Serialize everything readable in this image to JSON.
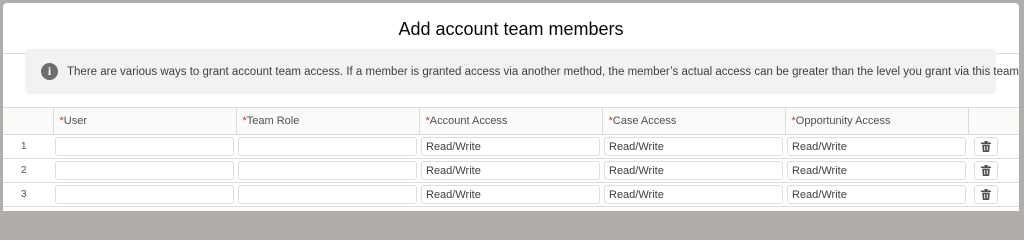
{
  "modal": {
    "title": "Add account team members"
  },
  "notice": {
    "icon": "info-icon",
    "text": "There are various ways to grant account team access. If a member is granted access via another method, the member’s actual access can be greater than the level you grant via this team."
  },
  "table": {
    "required_marker": "*",
    "headers": [
      "User",
      "Team Role",
      "Account Access",
      "Case Access",
      "Opportunity Access"
    ],
    "rows": [
      {
        "num": "1",
        "user": "",
        "role": "",
        "account_access": "Read/Write",
        "case_access": "Read/Write",
        "opportunity_access": "Read/Write"
      },
      {
        "num": "2",
        "user": "",
        "role": "",
        "account_access": "Read/Write",
        "case_access": "Read/Write",
        "opportunity_access": "Read/Write"
      },
      {
        "num": "3",
        "user": "",
        "role": "",
        "account_access": "Read/Write",
        "case_access": "Read/Write",
        "opportunity_access": "Read/Write"
      }
    ],
    "delete_icon": "trash-icon"
  },
  "colors": {
    "required": "#c23934",
    "info_icon_bg": "#706e6b",
    "notice_bg": "#f3f2f2"
  }
}
